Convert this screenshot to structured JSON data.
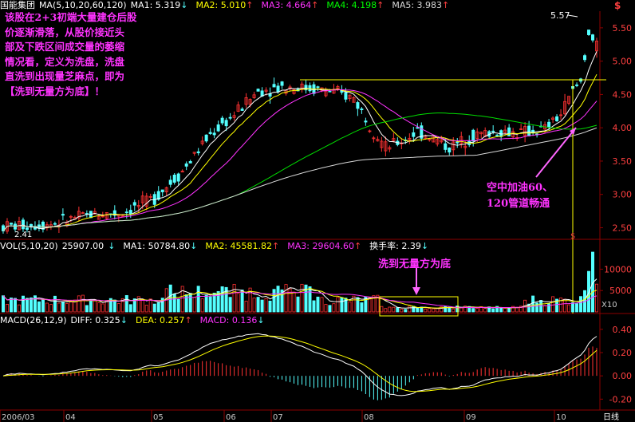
{
  "app": {
    "stock_name": "国能集团",
    "period_label": "日线",
    "x10_label": "X10"
  },
  "price_header": {
    "title": "MA(5,10,20,60,120)",
    "items": [
      {
        "label": "MA1: 5.319",
        "arrow": "↓",
        "color": "#ffffff"
      },
      {
        "label": "MA2: 5.010",
        "arrow": "↑",
        "color": "#ffff00"
      },
      {
        "label": "MA3: 4.664",
        "arrow": "↑",
        "color": "#ff33ff"
      },
      {
        "label": "MA4: 4.198",
        "arrow": "↑",
        "color": "#00ff00"
      },
      {
        "label": "MA5: 3.983",
        "arrow": "↑",
        "color": "#d8d8d8"
      }
    ]
  },
  "volume_header": {
    "title": "VOL(5,10,20)",
    "value": "25907.00",
    "value_arrow": "↓",
    "items": [
      {
        "label": "MA1: 50784.80",
        "arrow": "↓",
        "color": "#ffffff"
      },
      {
        "label": "MA2: 45581.82",
        "arrow": "↑",
        "color": "#ffff00"
      },
      {
        "label": "MA3: 29604.60",
        "arrow": "↑",
        "color": "#ff33ff"
      },
      {
        "label": "换手率: 2.39",
        "arrow": "↓",
        "color": "#ffffff"
      }
    ]
  },
  "macd_header": {
    "title": "MACD(26,12,9)",
    "items": [
      {
        "label": "DIFF: 0.325",
        "arrow": "↓",
        "color": "#ffffff"
      },
      {
        "label": "DEA: 0.257",
        "arrow": "↑",
        "color": "#ffff00"
      },
      {
        "label": "MACD: 0.136",
        "arrow": "↓",
        "color": "#ff33ff"
      }
    ]
  },
  "annotations": {
    "main_note_lines": [
      "该股在2+3初端大量建仓后股",
      "价逐渐滑落，从股价接近头",
      "部及下跌区间成交量的萎缩",
      "情况看，定义为洗盘，洗盘",
      "直洗到出现量芝麻点，即为",
      "【洗到无量方为底】！"
    ],
    "ma_note_lines": [
      "空中加油60、",
      "120管道畅通"
    ],
    "volume_note": "洗到无量方为底",
    "high_label": "5.57",
    "low_label": "2.41"
  },
  "colors": {
    "up": "#ff3232",
    "down": "#54ffff",
    "grid": "#8b0000",
    "yellow": "#ffff00"
  },
  "chart_data": [
    {
      "type": "candlestick",
      "name": "price",
      "x_axis_labels": [
        "2006/03",
        "04",
        "05",
        "06",
        "07",
        "08",
        "09",
        "10"
      ],
      "y_ticks": [
        "5.50",
        "5.00",
        "4.50",
        "4.00",
        "3.50",
        "3.00",
        "2.50"
      ],
      "ylim": [
        2.35,
        5.75
      ],
      "high": 5.57,
      "low": 2.41,
      "resistance_level": 4.72,
      "moving_averages": [
        "MA1",
        "MA2",
        "MA3",
        "MA4",
        "MA5"
      ]
    },
    {
      "type": "bar",
      "name": "volume",
      "y_ticks": [
        "10000",
        "5000"
      ],
      "ylim": [
        0,
        14000
      ],
      "unit": "X10"
    },
    {
      "type": "bar",
      "name": "macd",
      "y_ticks": [
        "0.40",
        "0.20",
        "0.00",
        "-0.20"
      ],
      "ylim": [
        -0.28,
        0.44
      ],
      "series": [
        "DIFF",
        "DEA",
        "MACD"
      ]
    }
  ]
}
